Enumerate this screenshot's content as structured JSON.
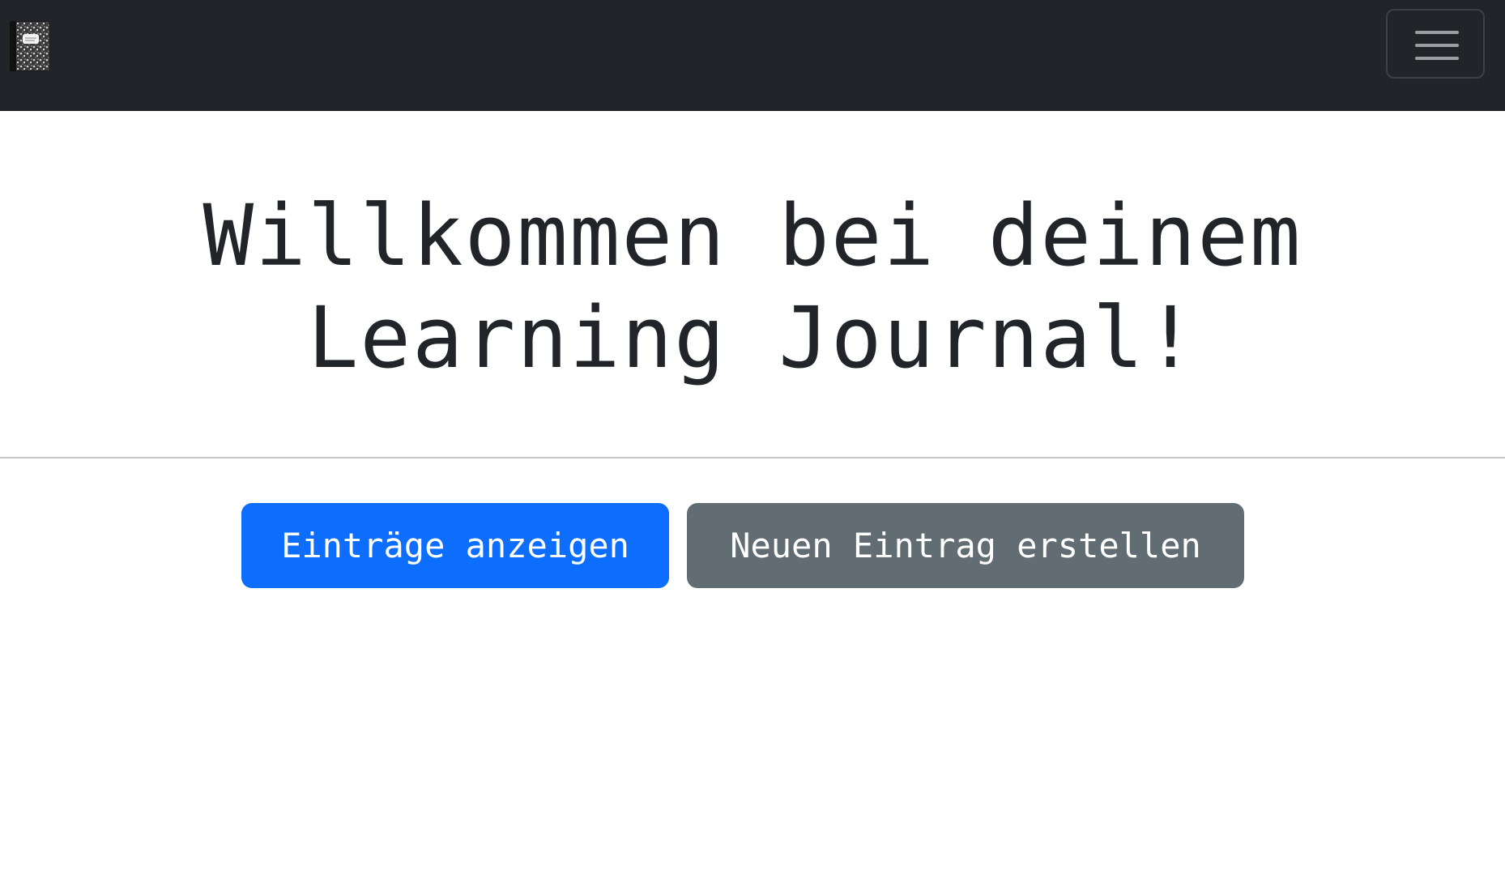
{
  "navbar": {
    "logo_icon": "composition-notebook-icon",
    "toggler_icon": "hamburger-menu-icon"
  },
  "hero": {
    "title_line1": "Willkommen bei deinem",
    "title_line2": "Learning Journal!"
  },
  "actions": {
    "view_entries_label": "Einträge anzeigen",
    "create_entry_label": "Neuen Eintrag erstellen"
  },
  "colors": {
    "navbar_bg": "#212529",
    "primary": "#0d6efd",
    "secondary": "#626c73"
  }
}
